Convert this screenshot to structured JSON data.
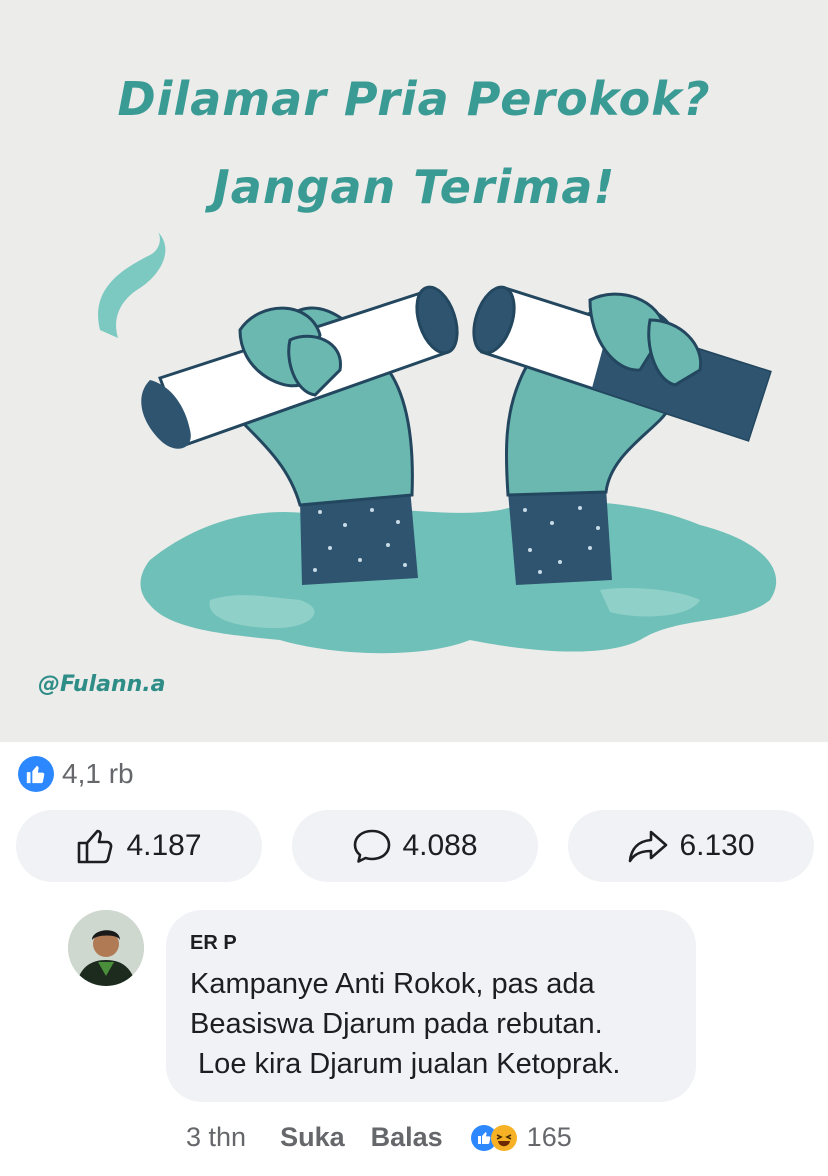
{
  "post": {
    "image": {
      "headline_line1": "Dilamar Pria Perokok?",
      "headline_line2": "Jangan Terima!",
      "watermark": "@Fulann.a",
      "accent_color": "#3a9a94"
    },
    "reactions": {
      "icon": "like-icon",
      "count": "4,1 rb"
    },
    "actions": {
      "like": {
        "icon": "thumbs-up-icon",
        "count": "4.187"
      },
      "comment": {
        "icon": "speech-bubble-icon",
        "count": "4.088"
      },
      "share": {
        "icon": "share-arrow-icon",
        "count": "6.130"
      }
    }
  },
  "comment": {
    "author": "ER P",
    "text": "Kampanye Anti Rokok, pas ada\nBeasiswa Djarum pada rebutan.\n Loe kira Djarum jualan Ketoprak.",
    "time": "3 thn",
    "like_label": "Suka",
    "reply_label": "Balas",
    "reaction_count": "165"
  },
  "colors": {
    "facebook_blue": "#2d88ff",
    "pill_bg": "#f0f2f5",
    "muted_text": "#65676b"
  }
}
